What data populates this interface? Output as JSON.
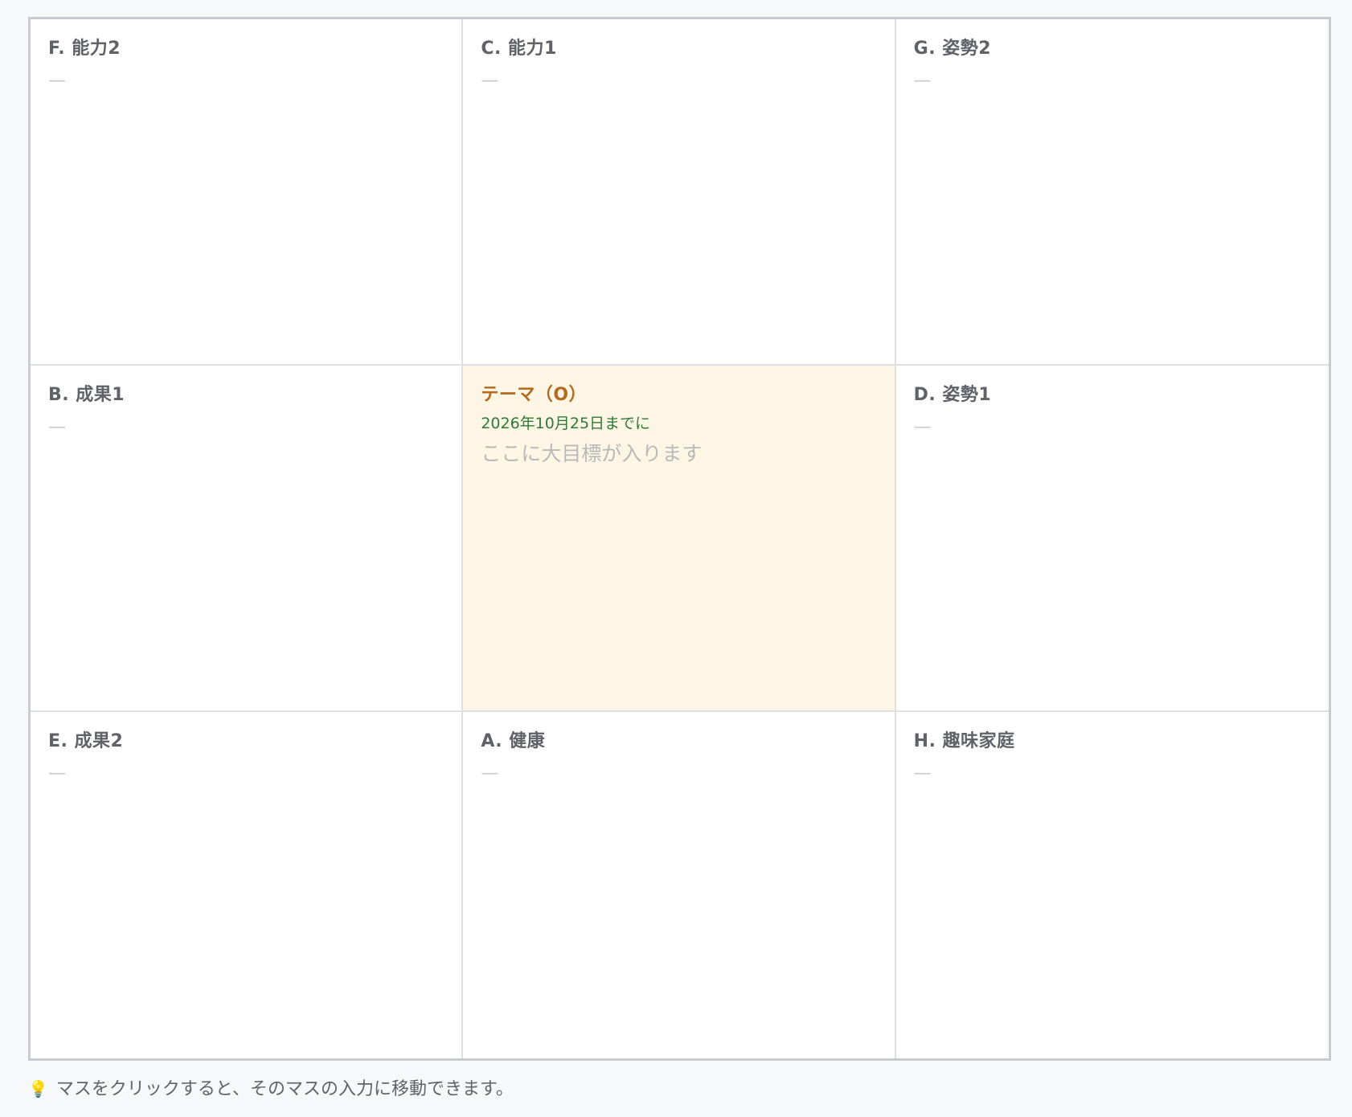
{
  "cells": {
    "f": {
      "title": "F. 能力2",
      "value": "—"
    },
    "c": {
      "title": "C. 能力1",
      "value": "—"
    },
    "g": {
      "title": "G. 姿勢2",
      "value": "—"
    },
    "b": {
      "title": "B. 成果1",
      "value": "—"
    },
    "center": {
      "title": "テーマ（O）",
      "deadline": "2026年10月25日までに",
      "goal_placeholder": "ここに大目標が入ります"
    },
    "d": {
      "title": "D. 姿勢1",
      "value": "—"
    },
    "e": {
      "title": "E. 成果2",
      "value": "—"
    },
    "a": {
      "title": "A. 健康",
      "value": "—"
    },
    "h": {
      "title": "H. 趣味家庭",
      "value": "—"
    }
  },
  "hint": {
    "icon": "lightbulb-icon",
    "text": "マスをクリックすると、そのマスの入力に移動できます。"
  },
  "colors": {
    "center_background": "#fef6e4",
    "center_title": "#b26b1f",
    "deadline": "#2f7a3a"
  }
}
